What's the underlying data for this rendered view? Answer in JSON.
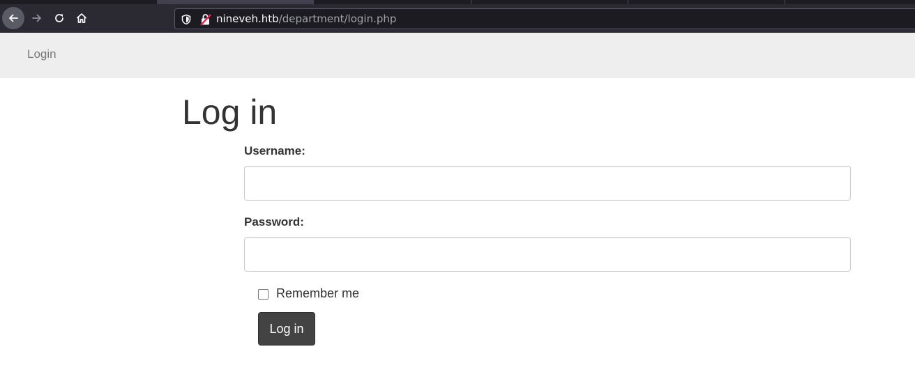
{
  "browser": {
    "url_host": "nineveh.htb",
    "url_path": "/department/login.php"
  },
  "navbar": {
    "brand_link": "Login"
  },
  "form": {
    "title": "Log in",
    "username_label": "Username:",
    "username_value": "",
    "password_label": "Password:",
    "password_value": "",
    "remember_label": "Remember me",
    "remember_checked": false,
    "submit_label": "Log in"
  },
  "colors": {
    "chrome_bg": "#2b2a33",
    "navbar_bg": "#eeeeee",
    "button_bg": "#434343"
  }
}
